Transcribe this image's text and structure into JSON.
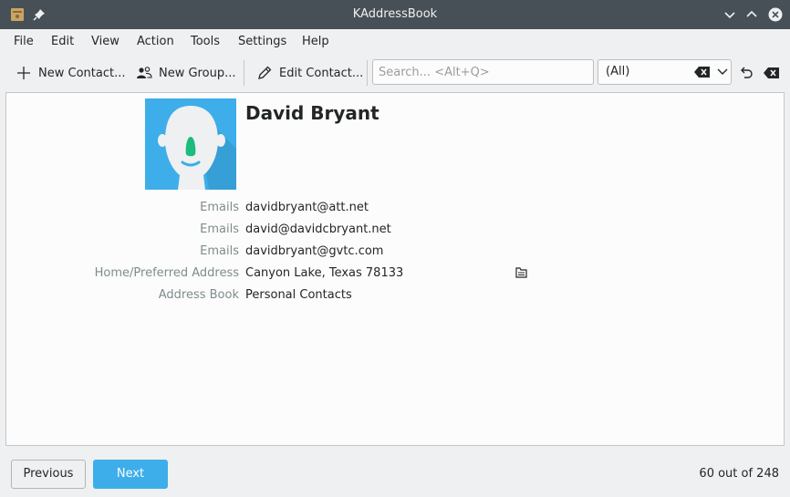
{
  "window": {
    "title": "KAddressBook"
  },
  "menu": [
    "File",
    "Edit",
    "View",
    "Action",
    "Tools",
    "Settings",
    "Help"
  ],
  "toolbar": {
    "new_contact": "New Contact...",
    "new_group": "New Group...",
    "edit_contact": "Edit Contact...",
    "search_placeholder": "Search... <Alt+Q>",
    "filter_value": "(All)"
  },
  "contact": {
    "name": "David Bryant",
    "fields": [
      {
        "label": "Emails",
        "value": "davidbryant@att.net"
      },
      {
        "label": "Emails",
        "value": "david@davidcbryant.net"
      },
      {
        "label": "Emails",
        "value": "davidbryant@gvtc.com"
      },
      {
        "label": "Home/Preferred Address",
        "value": "Canyon Lake, Texas 78133"
      },
      {
        "label": "Address Book",
        "value": "Personal Contacts"
      }
    ]
  },
  "nav": {
    "previous": "Previous",
    "next": "Next",
    "counter": "60 out of 248"
  },
  "colors": {
    "accent": "#3daee9",
    "titlebar": "#475057"
  }
}
